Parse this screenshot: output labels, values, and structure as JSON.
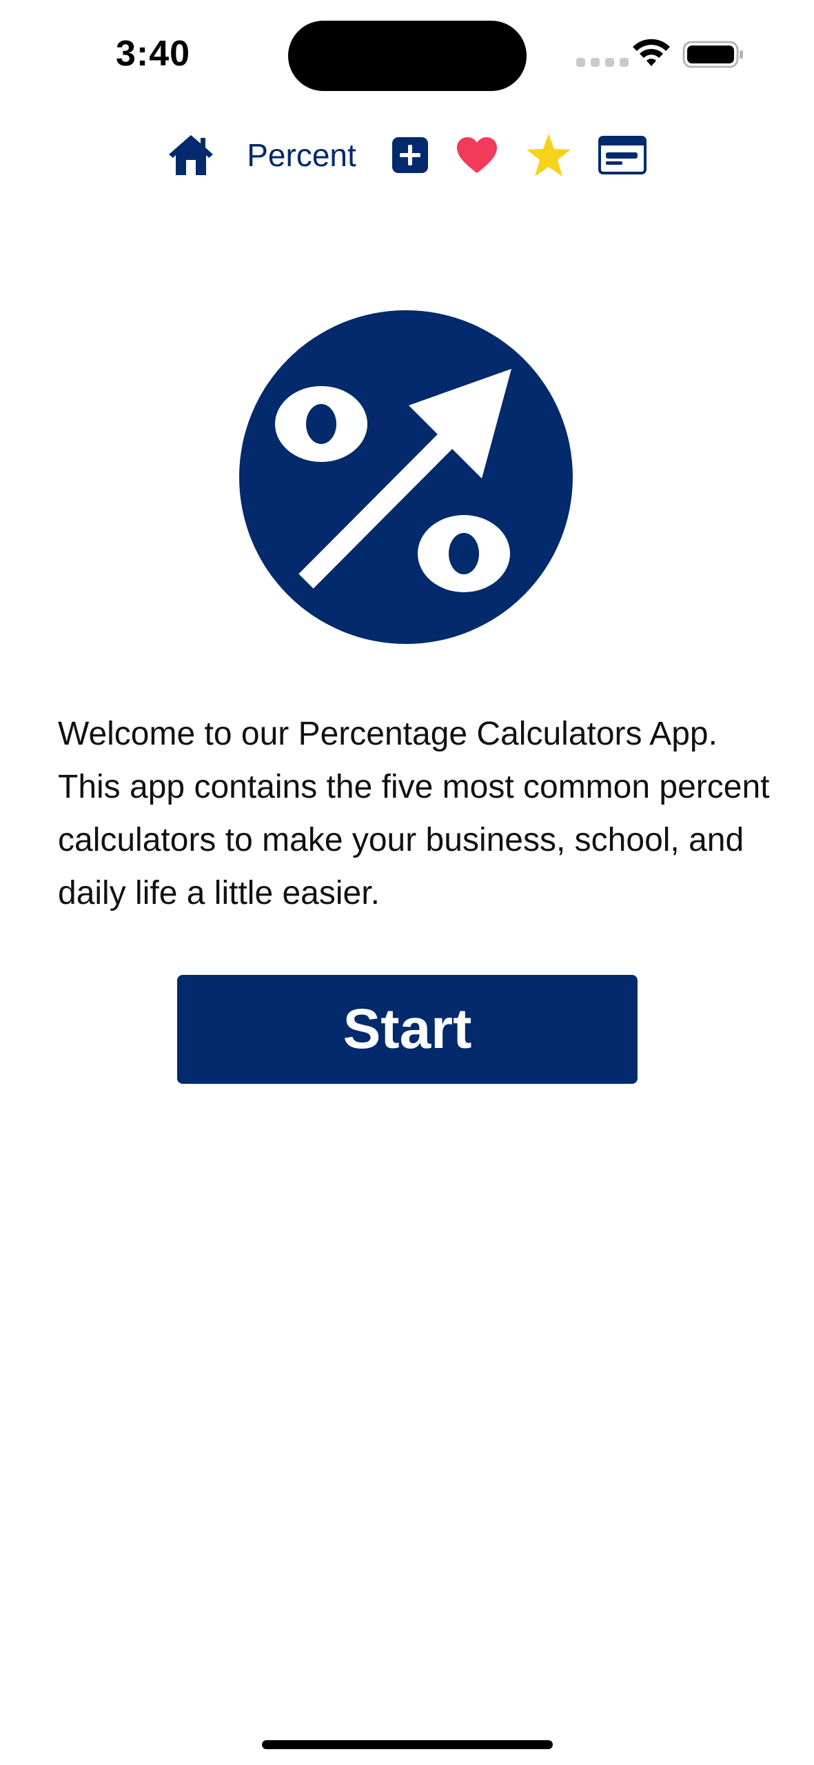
{
  "status_bar": {
    "time": "3:40",
    "icons": [
      "cellular-signal-icon",
      "wifi-icon",
      "battery-icon"
    ]
  },
  "navbar": {
    "title": "Percent",
    "icons": [
      "home-icon",
      "plus-square-icon",
      "heart-icon",
      "star-icon",
      "card-icon"
    ]
  },
  "main": {
    "welcome_text": "Welcome to our Percentage Calculators App. This app contains the five most common percent calculators to make your business, school, and daily life a little easier.",
    "start_label": "Start"
  },
  "colors": {
    "brand_navy": "#022a6c",
    "heart": "#f23a5a",
    "star": "#f7d21a",
    "background": "#ffffff"
  }
}
